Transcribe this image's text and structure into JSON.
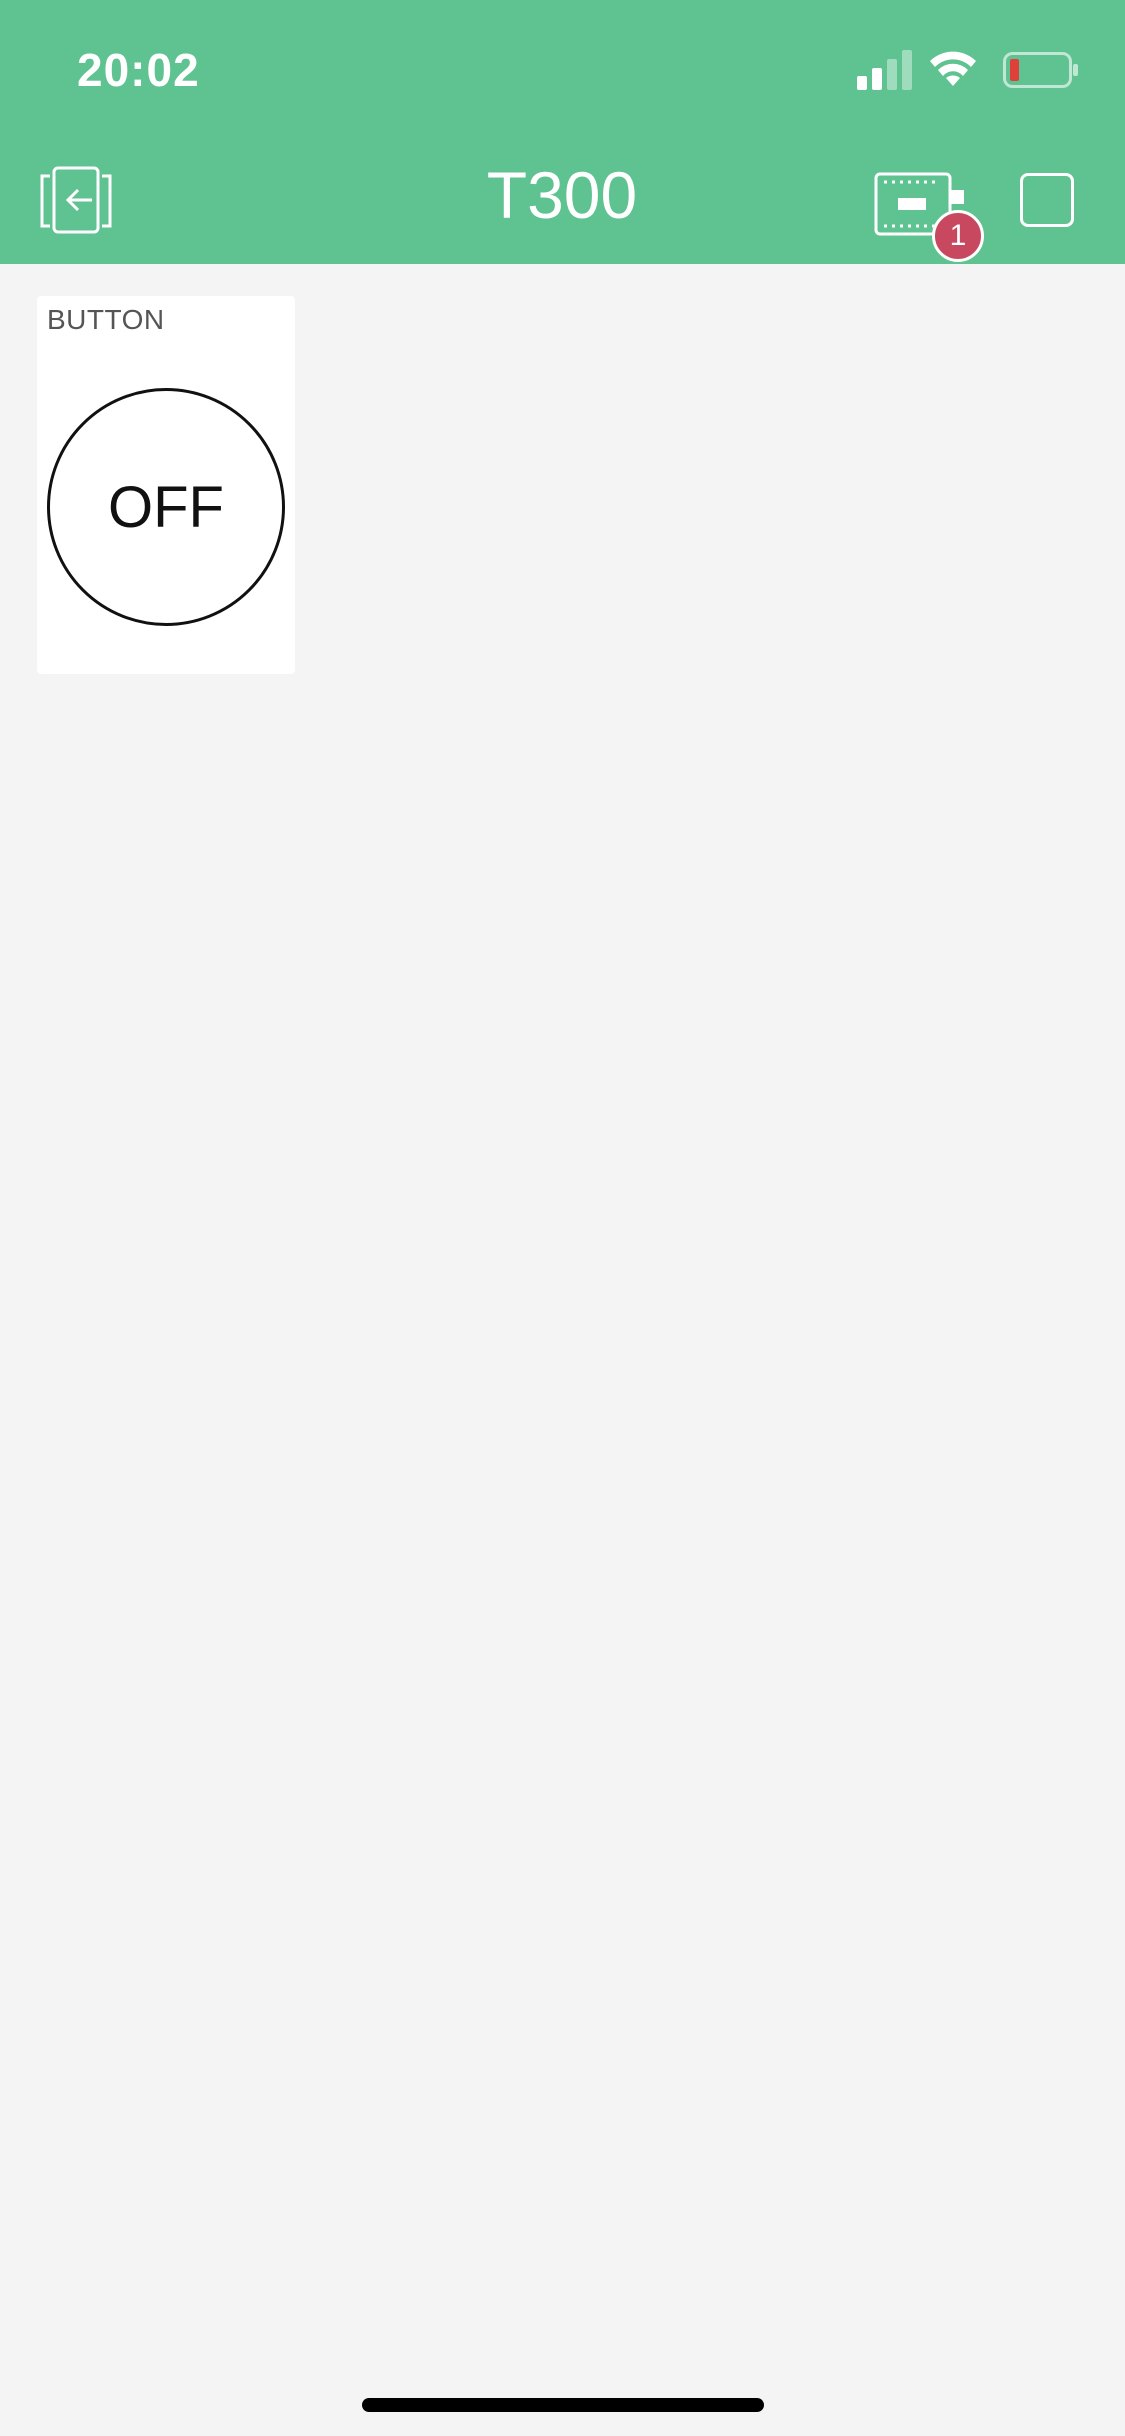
{
  "status_bar": {
    "time": "20:02",
    "icons": [
      "cellular-signal-icon",
      "wifi-icon",
      "battery-icon"
    ],
    "battery_color": "#e0403b"
  },
  "header": {
    "title": "T300",
    "background_color": "#5fc391",
    "back_icon": "exit-project-icon",
    "device_icon": "device-board-icon",
    "device_badge_count": "1",
    "badge_color": "#c8485f",
    "stop_icon": "stop-square-icon"
  },
  "widgets": [
    {
      "label": "BUTTON",
      "state_text": "OFF"
    }
  ]
}
